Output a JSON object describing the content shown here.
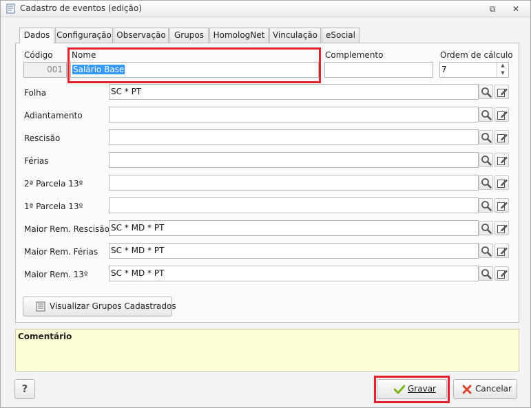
{
  "window": {
    "title": "Cadastro de eventos (edição)",
    "restore_symbol": "⧉",
    "close_symbol": "✕"
  },
  "tabs": [
    {
      "label": "Dados",
      "active": true
    },
    {
      "label": "Configuração",
      "active": false
    },
    {
      "label": "Observação",
      "active": false
    },
    {
      "label": "Grupos",
      "active": false
    },
    {
      "label": "HomologNet",
      "active": false
    },
    {
      "label": "Vinculação",
      "active": false
    },
    {
      "label": "eSocial",
      "active": false
    }
  ],
  "header_fields": {
    "codigo": {
      "label": "Código",
      "value": "001"
    },
    "nome": {
      "label": "Nome",
      "value": "Salário Base"
    },
    "complemento": {
      "label": "Complemento",
      "value": ""
    },
    "ordem": {
      "label": "Ordem de cálculo",
      "value": "7"
    }
  },
  "formula_rows": [
    {
      "label": "Folha",
      "value": "SC * PT"
    },
    {
      "label": "Adiantamento",
      "value": ""
    },
    {
      "label": "Rescisão",
      "value": ""
    },
    {
      "label": "Férias",
      "value": ""
    },
    {
      "label": "2ª Parcela 13º",
      "value": ""
    },
    {
      "label": "1ª Parcela 13º",
      "value": ""
    },
    {
      "label": "Maior Rem. Rescisão",
      "value": "SC * MD * PT"
    },
    {
      "label": "Maior Rem. Férias",
      "value": "SC * MD * PT"
    },
    {
      "label": "Maior Rem. 13º",
      "value": "SC * MD * PT"
    }
  ],
  "buttons": {
    "view_groups": "Visualizar Grupos Cadastrados",
    "help": "?",
    "save": "Gravar",
    "cancel": "Cancelar"
  },
  "comment": {
    "title": "Comentário",
    "value": ""
  },
  "icons": {
    "search": "magnifier-icon",
    "edit": "edit-icon",
    "spin_up": "▲",
    "spin_down": "▼"
  },
  "colors": {
    "highlight": "#e0202a",
    "selection": "#3399ff",
    "comment_bg": "#ffffd7"
  }
}
